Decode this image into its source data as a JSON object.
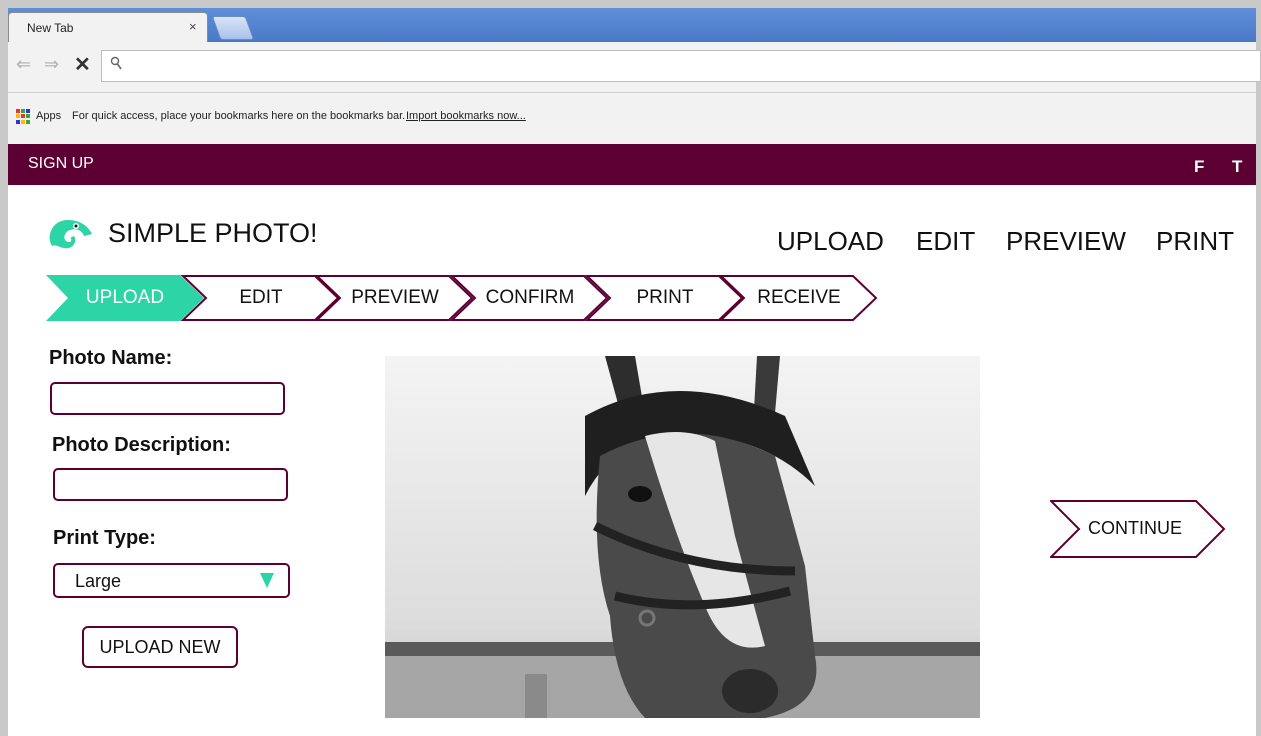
{
  "browser": {
    "tab_title": "New Tab",
    "tab_close": "×",
    "bookmarks": {
      "apps_label": "Apps",
      "hint": "For quick access, place your bookmarks here on the bookmarks bar.",
      "import_link": "Import bookmarks now..."
    }
  },
  "site": {
    "signup": "SIGN UP",
    "social": [
      "F",
      "T"
    ],
    "brand": "SIMPLE PHOTO!",
    "brand_color": "#5c0033",
    "accent_color": "#2dd4a6",
    "nav": [
      "UPLOAD",
      "EDIT",
      "PREVIEW",
      "PRINT"
    ],
    "steps": [
      {
        "label": "UPLOAD",
        "active": true
      },
      {
        "label": "EDIT",
        "active": false
      },
      {
        "label": "PREVIEW",
        "active": false
      },
      {
        "label": "CONFIRM",
        "active": false
      },
      {
        "label": "PRINT",
        "active": false
      },
      {
        "label": "RECEIVE",
        "active": false
      }
    ],
    "form": {
      "photo_name_label": "Photo Name:",
      "photo_name_value": "",
      "photo_description_label": "Photo Description:",
      "photo_description_value": "",
      "print_type_label": "Print Type:",
      "print_type_value": "Large",
      "upload_new_label": "UPLOAD NEW"
    },
    "continue_label": "CONTINUE"
  }
}
